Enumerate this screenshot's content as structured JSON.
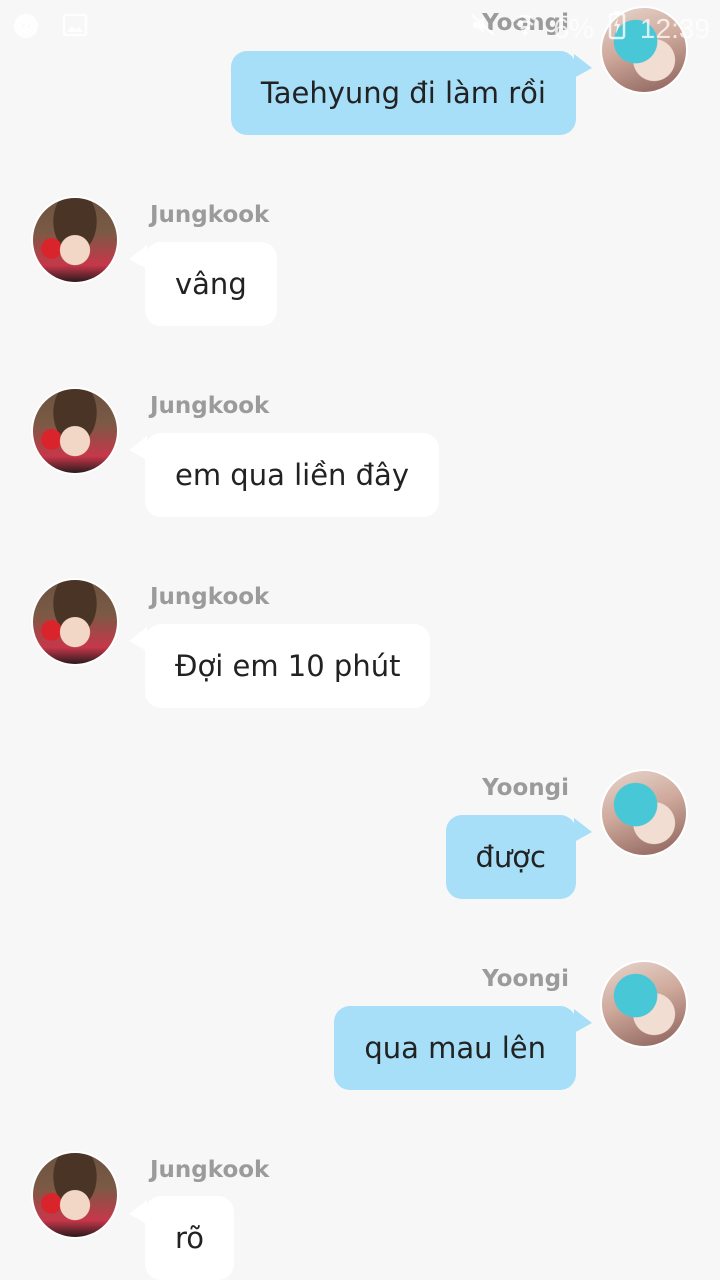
{
  "status_bar": {
    "time": "12:39",
    "battery": "6%",
    "icons": [
      "messenger-icon",
      "image-icon",
      "mute-icon",
      "wifi-icon",
      "battery-icon"
    ]
  },
  "messages": [
    {
      "sender": "Yoongi",
      "side": "right",
      "text": "Taehyung đi làm rồi"
    },
    {
      "sender": "Jungkook",
      "side": "left",
      "text": "vâng"
    },
    {
      "sender": "Jungkook",
      "side": "left",
      "text": "em qua liền đây"
    },
    {
      "sender": "Jungkook",
      "side": "left",
      "text": "Đợi em 10 phút"
    },
    {
      "sender": "Yoongi",
      "side": "right",
      "text": "được"
    },
    {
      "sender": "Yoongi",
      "side": "right",
      "text": "qua mau lên"
    },
    {
      "sender": "Jungkook",
      "side": "left",
      "text": "rõ"
    }
  ],
  "colors": {
    "background": "#f7f7f7",
    "left_bubble": "#ffffff",
    "right_bubble": "#a7def8",
    "name_text": "#9b9b9b"
  }
}
